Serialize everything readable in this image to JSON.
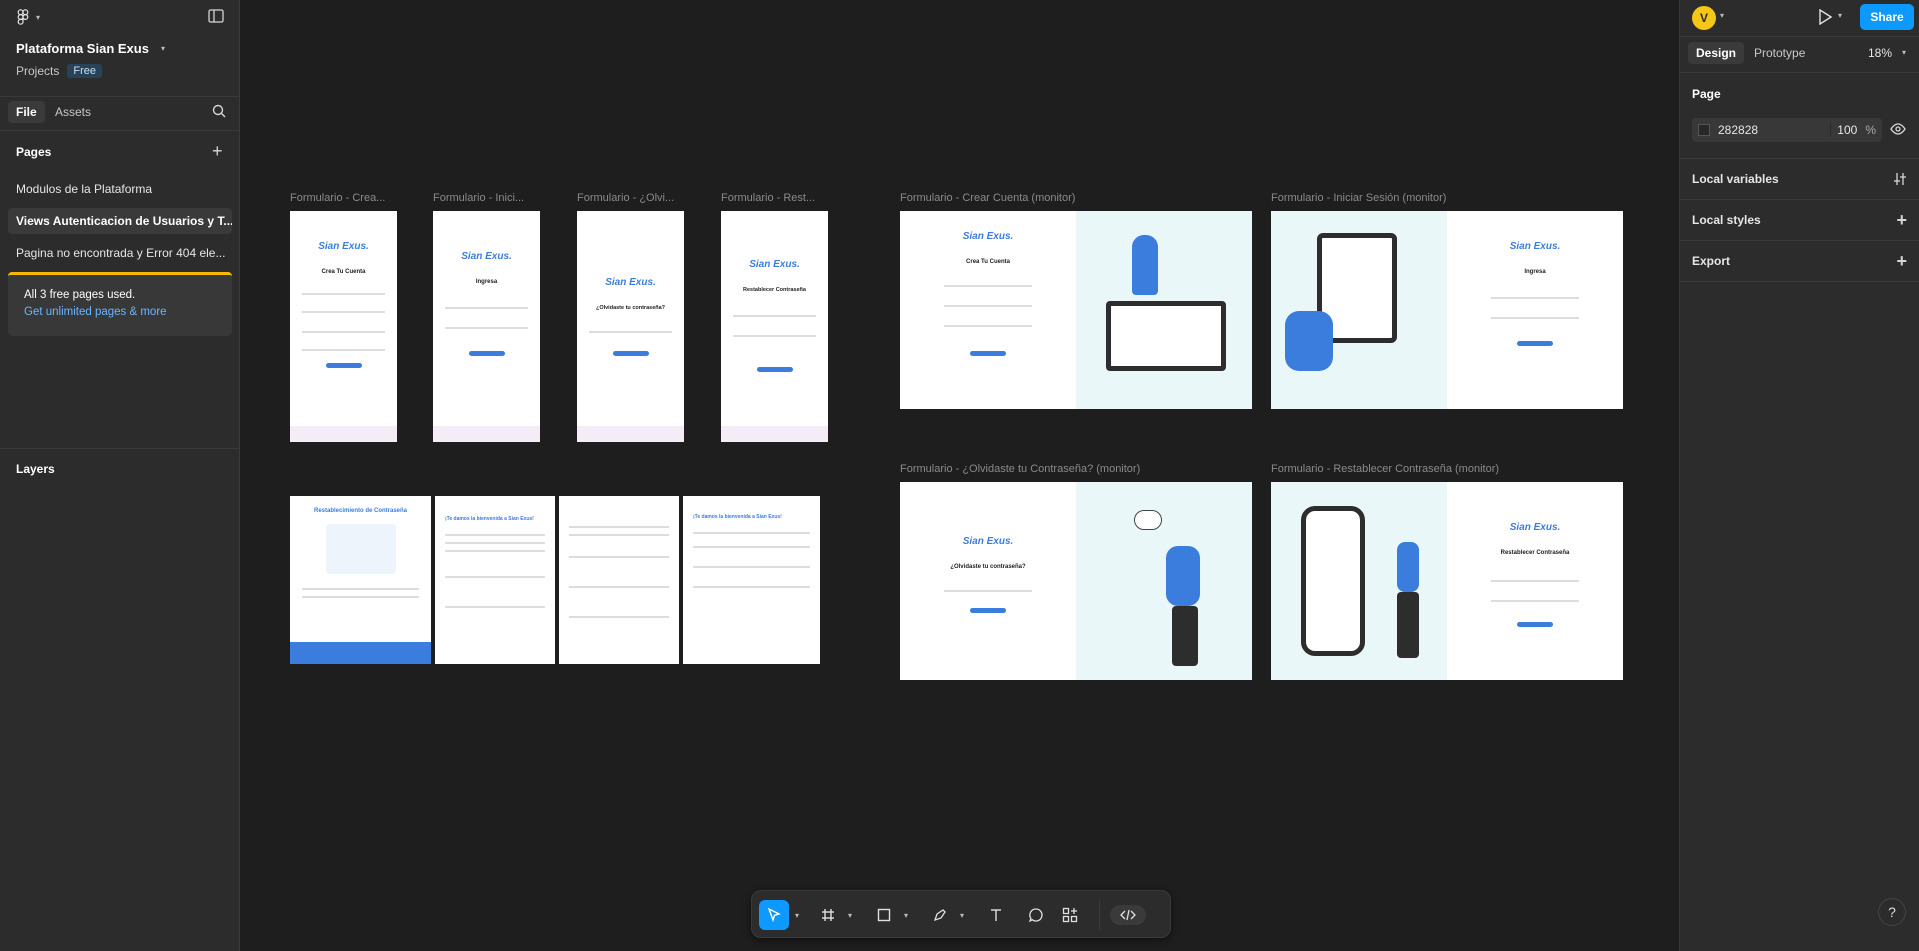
{
  "file": {
    "name": "Plataforma Sian Exus",
    "projects": "Projects",
    "plan": "Free"
  },
  "left_tabs": {
    "file": "File",
    "assets": "Assets"
  },
  "pages": {
    "heading": "Pages",
    "items": [
      {
        "label": "Modulos de la Plataforma"
      },
      {
        "label": "Views Autenticacion de Usuarios y T..."
      },
      {
        "label": "Pagina no encontrada y Error 404 ele..."
      }
    ],
    "notice": "All 3 free pages used.",
    "upgrade_link": "Get unlimited pages & more"
  },
  "layers": {
    "heading": "Layers"
  },
  "header": {
    "avatar_initial": "V",
    "share": "Share"
  },
  "right_tabs": {
    "design": "Design",
    "prototype": "Prototype",
    "zoom": "18%"
  },
  "page_props": {
    "title": "Page",
    "bg_hex": "282828",
    "opacity": "100",
    "pct": "%",
    "local_variables": "Local variables",
    "local_styles": "Local styles",
    "export": "Export"
  },
  "frames": {
    "mobile_labels": [
      "Formulario - Crea...",
      "Formulario - Inici...",
      "Formulario - ¿Olvi...",
      "Formulario - Rest..."
    ],
    "mobile_titles": [
      "Crea Tu Cuenta",
      "Ingresa",
      "¿Olvidaste tu contraseña?",
      "Restablecer Contraseña"
    ],
    "monitor_labels": [
      "Formulario - Crear Cuenta (monitor)",
      "Formulario - Iniciar Sesión (monitor)",
      "Formulario - ¿Olvidaste tu Contraseña? (monitor)",
      "Formulario - Restablecer Contraseña (monitor)"
    ],
    "monitor_titles": [
      "Crea Tu Cuenta",
      "Ingresa",
      "¿Olvidaste tu contraseña?",
      "Restablecer Contraseña"
    ],
    "brand": "Sian Exus.",
    "email_titles": [
      "Restablecimiento de Contraseña",
      "¡Te damos la bienvenida a Sian Exus!",
      "",
      "¡Te damos la bienvenida a Sian Exus!"
    ]
  },
  "colors": {
    "accent": "#0d99ff",
    "brand_blue": "#3b7ddd",
    "canvas": "#1e1e1e",
    "panel": "#2c2c2c"
  }
}
